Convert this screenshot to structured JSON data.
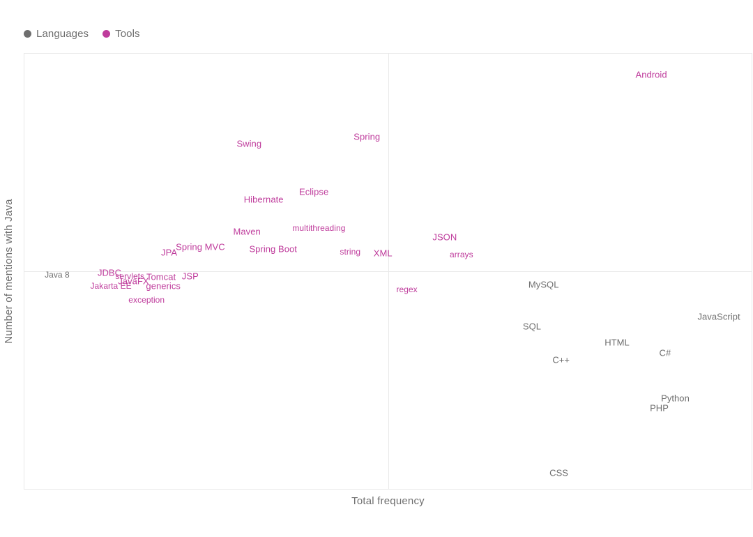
{
  "legend": {
    "position": "top-left",
    "entries": [
      {
        "label": "Languages",
        "color": "#6e6e6e",
        "marker": "circle"
      },
      {
        "label": "Tools",
        "color": "#bf3c9c",
        "marker": "circle"
      }
    ]
  },
  "axes": {
    "xlabel": "Total frequency",
    "ylabel": "Number of mentions with Java"
  },
  "chart_data": {
    "type": "scatter",
    "title": "",
    "subtitle": "",
    "xlabel": "Total frequency",
    "ylabel": "Number of mentions with Java",
    "grid": false,
    "legend_position": "top-left",
    "annotation_style": "text-labels-only",
    "quadrant_lines": {
      "x": 0.5,
      "y": 0.5
    },
    "xlim": [
      0,
      1
    ],
    "ylim": [
      0,
      1
    ],
    "series": [
      {
        "name": "Tools",
        "color": "#bf3c9c",
        "points": [
          {
            "label": "Android",
            "x": 0.862,
            "y": 0.952
          },
          {
            "label": "Spring",
            "x": 0.471,
            "y": 0.809
          },
          {
            "label": "Swing",
            "x": 0.309,
            "y": 0.794
          },
          {
            "label": "Eclipse",
            "x": 0.398,
            "y": 0.682
          },
          {
            "label": "Hibernate",
            "x": 0.329,
            "y": 0.665
          },
          {
            "label": "multithreading",
            "x": 0.405,
            "y": 0.6
          },
          {
            "label": "Maven",
            "x": 0.306,
            "y": 0.592
          },
          {
            "label": "JSON",
            "x": 0.578,
            "y": 0.578
          },
          {
            "label": "arrays",
            "x": 0.601,
            "y": 0.539
          },
          {
            "label": "Spring Boot",
            "x": 0.342,
            "y": 0.552
          },
          {
            "label": "Spring MVC",
            "x": 0.242,
            "y": 0.556
          },
          {
            "label": "string",
            "x": 0.448,
            "y": 0.545
          },
          {
            "label": "XML",
            "x": 0.493,
            "y": 0.542
          },
          {
            "label": "JPA",
            "x": 0.199,
            "y": 0.544
          },
          {
            "label": "JDBC",
            "x": 0.117,
            "y": 0.496
          },
          {
            "label": "servlets",
            "x": 0.145,
            "y": 0.488
          },
          {
            "label": "Tomcat",
            "x": 0.188,
            "y": 0.487
          },
          {
            "label": "JSP",
            "x": 0.228,
            "y": 0.488
          },
          {
            "label": "JavaFX",
            "x": 0.15,
            "y": 0.477
          },
          {
            "label": "generics",
            "x": 0.191,
            "y": 0.466
          },
          {
            "label": "Jakarta EE",
            "x": 0.119,
            "y": 0.466
          },
          {
            "label": "exception",
            "x": 0.168,
            "y": 0.434
          },
          {
            "label": "regex",
            "x": 0.526,
            "y": 0.458
          }
        ]
      },
      {
        "name": "Languages",
        "color": "#6e6e6e",
        "points": [
          {
            "label": "Java 8",
            "x": 0.045,
            "y": 0.492
          },
          {
            "label": "MySQL",
            "x": 0.714,
            "y": 0.469
          },
          {
            "label": "JavaScript",
            "x": 0.955,
            "y": 0.396
          },
          {
            "label": "SQL",
            "x": 0.698,
            "y": 0.373
          },
          {
            "label": "HTML",
            "x": 0.815,
            "y": 0.336
          },
          {
            "label": "C#",
            "x": 0.881,
            "y": 0.312
          },
          {
            "label": "C++",
            "x": 0.738,
            "y": 0.297
          },
          {
            "label": "Python",
            "x": 0.895,
            "y": 0.209
          },
          {
            "label": "PHP",
            "x": 0.873,
            "y": 0.186
          },
          {
            "label": "CSS",
            "x": 0.735,
            "y": 0.037
          }
        ]
      }
    ]
  },
  "style": {
    "tools_color": "#bf3c9c",
    "languages_color": "#6e6e6e",
    "border_color": "#e9e9e9",
    "background": "#ffffff"
  },
  "label_sizes": {
    "Android": 13,
    "Spring": 13,
    "Swing": 13,
    "Eclipse": 13,
    "Hibernate": 13,
    "multithreading": 12,
    "Maven": 13,
    "JSON": 13,
    "arrays": 12,
    "Spring Boot": 13,
    "Spring MVC": 13,
    "string": 12,
    "XML": 13,
    "JPA": 13,
    "JDBC": 13,
    "servlets": 12,
    "Tomcat": 13,
    "JSP": 13,
    "JavaFX": 13,
    "generics": 13,
    "Jakarta EE": 12,
    "exception": 12,
    "regex": 12,
    "Java 8": 12,
    "MySQL": 13,
    "JavaScript": 13,
    "SQL": 13,
    "HTML": 13,
    "C#": 13,
    "C++": 13,
    "Python": 13,
    "PHP": 13,
    "CSS": 13
  }
}
